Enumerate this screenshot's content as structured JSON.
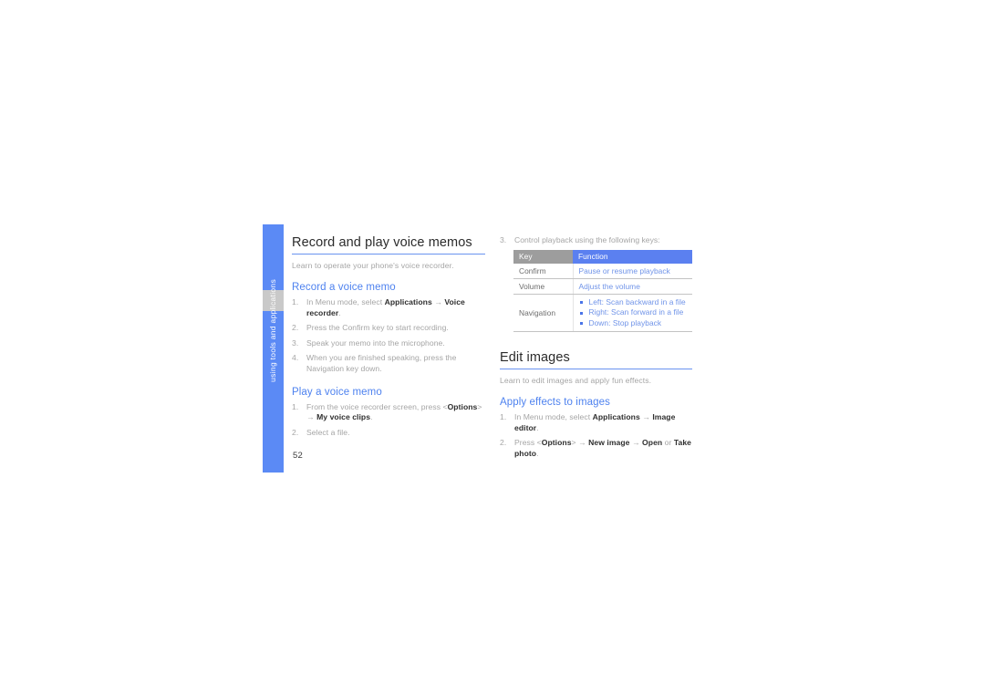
{
  "page": {
    "number": "52",
    "side_tab_label": "using tools and applications"
  },
  "left_column": {
    "section_title": "Record and play voice memos",
    "section_lede": "Learn to operate your phone's voice recorder.",
    "subsection_1": {
      "title": "Record a voice memo",
      "steps": [
        {
          "num": "1.",
          "html": "In Menu mode, select <b>Applications</b> → <b>Voice recorder</b>."
        },
        {
          "num": "2.",
          "html": "Press the Confirm key to start recording."
        },
        {
          "num": "3.",
          "html": "Speak your memo into the microphone."
        },
        {
          "num": "4.",
          "html": "When you are finished speaking, press the Navigation key down."
        }
      ]
    },
    "subsection_2": {
      "title": "Play a voice memo",
      "steps": [
        {
          "num": "1.",
          "html": "From the voice recorder screen, press &lt;<b>Options</b>&gt; → <b>My voice clips</b>."
        },
        {
          "num": "2.",
          "html": "Select a file."
        }
      ]
    }
  },
  "right_column": {
    "table_intro": {
      "num": "3.",
      "text": "Control playback using the following keys:"
    },
    "key_table": {
      "headers": [
        "Key",
        "Function"
      ],
      "rows": [
        {
          "key": "Confirm",
          "function": "Pause or resume playback",
          "bullets": []
        },
        {
          "key": "Volume",
          "function": "Adjust the volume",
          "bullets": []
        },
        {
          "key": "Navigation",
          "function": "",
          "bullets": [
            "Left: Scan backward in a file",
            "Right: Scan forward in a file",
            "Down: Stop playback"
          ]
        }
      ]
    },
    "section_title": "Edit images",
    "section_lede": "Learn to edit images and apply fun effects.",
    "subsection_1": {
      "title": "Apply effects to images",
      "steps": [
        {
          "num": "1.",
          "html": "In Menu mode, select <b>Applications</b> → <b>Image editor</b>."
        },
        {
          "num": "2.",
          "html": "Press &lt;<b>Options</b>&gt; → <b>New image</b> → <b>Open</b> or <b>Take photo</b>."
        }
      ]
    }
  },
  "colors": {
    "accent_blue": "#5b80f0",
    "side_tab_blue": "#5b8af5",
    "heading_rule": "#6a93f0",
    "body_gray": "#a5a5a5",
    "table_key_header_gray": "#9d9d9d"
  }
}
